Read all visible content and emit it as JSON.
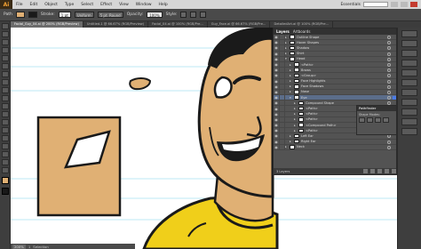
{
  "app": {
    "logo": "Ai",
    "menus": [
      "File",
      "Edit",
      "Object",
      "Type",
      "Select",
      "Effect",
      "View",
      "Window",
      "Help"
    ],
    "workspace": "Essentials"
  },
  "control_bar": {
    "selection_label": "Path",
    "stroke_label": "Stroke:",
    "stroke_value": "1 pt",
    "profile": "Uniform",
    "brush": "5 pt. Round",
    "opacity_label": "Opacity:",
    "opacity_value": "100%",
    "style_label": "Style:"
  },
  "tabs": [
    {
      "label": "Facial_Guy_04.ai @ 200% (RGB/Preview)",
      "active": true
    },
    {
      "label": "Untitled-1 @ 66.67% (RGB/Preview)",
      "active": false
    },
    {
      "label": "Facial_04.ai @ 100% (RGB/Pre...",
      "active": false
    },
    {
      "label": "Guy_Face.ai @ 66.67% (RGB/Pre...",
      "active": false
    },
    {
      "label": "DetailedArt.ai @ 100% (RGB/Pre...",
      "active": false
    }
  ],
  "layers_panel": {
    "tabs": [
      "Layers",
      "Artboards"
    ],
    "rows": [
      {
        "name": "Outline Shape",
        "indent": 0,
        "expanded": false,
        "selected": false
      },
      {
        "name": "Hover Shapes",
        "indent": 0,
        "expanded": false,
        "selected": false
      },
      {
        "name": "Shadow",
        "indent": 0,
        "expanded": false,
        "selected": false
      },
      {
        "name": "Shirt",
        "indent": 0,
        "expanded": false,
        "selected": false
      },
      {
        "name": "Head",
        "indent": 0,
        "expanded": true,
        "selected": false
      },
      {
        "name": "<Path>",
        "indent": 1,
        "expanded": false,
        "selected": false
      },
      {
        "name": "Brows",
        "indent": 1,
        "expanded": false,
        "selected": false
      },
      {
        "name": "<Group>",
        "indent": 1,
        "expanded": false,
        "selected": false
      },
      {
        "name": "Face Highlights",
        "indent": 1,
        "expanded": false,
        "selected": false
      },
      {
        "name": "Face Shadows",
        "indent": 1,
        "expanded": false,
        "selected": false
      },
      {
        "name": "Nose",
        "indent": 1,
        "expanded": false,
        "selected": false
      },
      {
        "name": "Eye",
        "indent": 1,
        "expanded": true,
        "selected": true
      },
      {
        "name": "Compound Shape",
        "indent": 2,
        "expanded": false,
        "selected": false
      },
      {
        "name": "<Path>",
        "indent": 2,
        "expanded": false,
        "selected": false
      },
      {
        "name": "<Path>",
        "indent": 2,
        "expanded": false,
        "selected": false
      },
      {
        "name": "<Path>",
        "indent": 2,
        "expanded": false,
        "selected": false
      },
      {
        "name": "<Compound Path>",
        "indent": 2,
        "expanded": false,
        "selected": false
      },
      {
        "name": "<Path>",
        "indent": 2,
        "expanded": false,
        "selected": false
      },
      {
        "name": "Left Ear",
        "indent": 1,
        "expanded": false,
        "selected": false
      },
      {
        "name": "Right Ear",
        "indent": 1,
        "expanded": false,
        "selected": false
      },
      {
        "name": "Neck",
        "indent": 0,
        "expanded": false,
        "selected": false
      }
    ],
    "footer_count": "3 Layers"
  },
  "pathfinder": {
    "title": "Pathfinder",
    "shape_modes_label": "Shape Modes:"
  },
  "status": {
    "zoom": "200%",
    "page": "1",
    "tool": "Selection"
  },
  "colors": {
    "skin": "#e0b074",
    "shirt": "#f0cf1a",
    "outline": "#1a1a1a",
    "selection": "#5b6d8a",
    "guide": "#7fd4ec"
  }
}
